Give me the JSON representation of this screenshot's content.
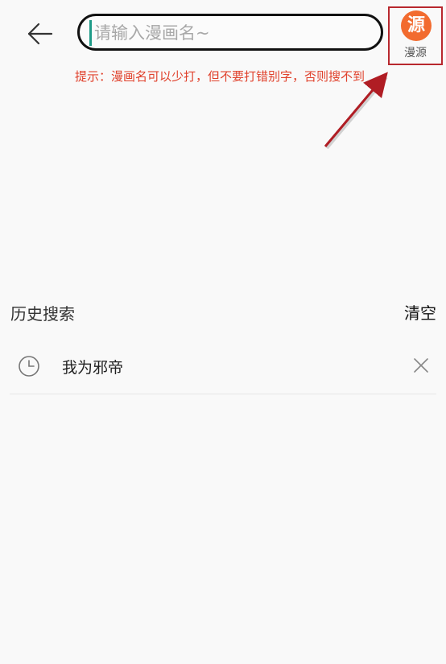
{
  "header": {
    "back_icon": "arrow-left-icon",
    "search": {
      "value": "",
      "placeholder": "请输入漫画名~"
    },
    "source_button": {
      "badge": "源",
      "label": "漫源",
      "accent_color": "#f26b2f"
    }
  },
  "hint": "提示：漫画名可以少打，但不要打错别字，否则搜不到",
  "history": {
    "title": "历史搜索",
    "clear_label": "清空",
    "items": [
      {
        "text": "我为邪帝",
        "icon": "clock-icon",
        "delete_icon": "close-icon"
      }
    ]
  },
  "colors": {
    "hint": "#e0412c",
    "annotation": "#b8282e"
  }
}
